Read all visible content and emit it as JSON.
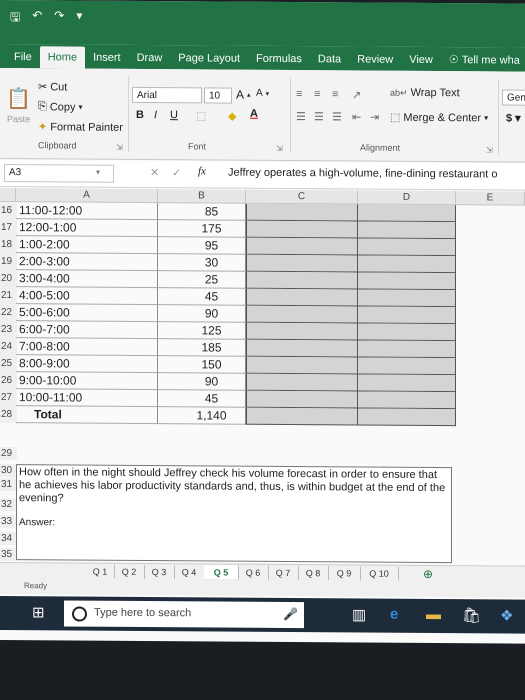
{
  "qat": {
    "save_icon": "save-icon",
    "undo_icon": "undo-icon",
    "redo_icon": "redo-icon"
  },
  "tabs": [
    "File",
    "Home",
    "Insert",
    "Draw",
    "Page Layout",
    "Formulas",
    "Data",
    "Review",
    "View"
  ],
  "tell_me": "Tell me wha",
  "ribbon": {
    "cut": "Cut",
    "copy": "Copy",
    "paste": "Paste",
    "format_painter": "Format Painter",
    "font_name": "Arial",
    "font_size": "10",
    "wrap_text": "Wrap Text",
    "merge_center": "Merge & Center",
    "general": "Gen",
    "group_clipboard": "Clipboard",
    "group_font": "Font",
    "group_alignment": "Alignment"
  },
  "formula_bar": {
    "name_box": "A3",
    "fx": "fx",
    "formula": "Jeffrey operates a high-volume, fine-dining restaurant o"
  },
  "columns": [
    "A",
    "B",
    "C",
    "D",
    "E"
  ],
  "rows": [
    {
      "num": "16",
      "time": "11:00-12:00",
      "value": "85"
    },
    {
      "num": "17",
      "time": "12:00-1:00",
      "value": "175"
    },
    {
      "num": "18",
      "time": "1:00-2:00",
      "value": "95"
    },
    {
      "num": "19",
      "time": "2:00-3:00",
      "value": "30"
    },
    {
      "num": "20",
      "time": "3:00-4:00",
      "value": "25"
    },
    {
      "num": "21",
      "time": "4:00-5:00",
      "value": "45"
    },
    {
      "num": "22",
      "time": "5:00-6:00",
      "value": "90"
    },
    {
      "num": "23",
      "time": "6:00-7:00",
      "value": "125"
    },
    {
      "num": "24",
      "time": "7:00-8:00",
      "value": "185"
    },
    {
      "num": "25",
      "time": "8:00-9:00",
      "value": "150"
    },
    {
      "num": "26",
      "time": "9:00-10:00",
      "value": "90"
    },
    {
      "num": "27",
      "time": "10:00-11:00",
      "value": "45"
    }
  ],
  "total": {
    "num": "28",
    "label": "Total",
    "value": "1,140"
  },
  "question": {
    "rows": [
      "29",
      "30",
      "31",
      "32",
      "33",
      "34",
      "35"
    ],
    "text": "How often in the night should Jeffrey check his volume forecast in order to ensure that he achieves his labor productivity standards and, thus, is within budget at the end of the evening?",
    "answer_label": "Answer:"
  },
  "sheet_tabs": [
    "Q 1",
    "Q 2",
    "Q 3",
    "Q 4",
    "Q 5",
    "Q 6",
    "Q 7",
    "Q 8",
    "Q 9",
    "Q 10"
  ],
  "active_sheet": "Q 5",
  "status": "Ready",
  "taskbar": {
    "search_placeholder": "Type here to search"
  }
}
